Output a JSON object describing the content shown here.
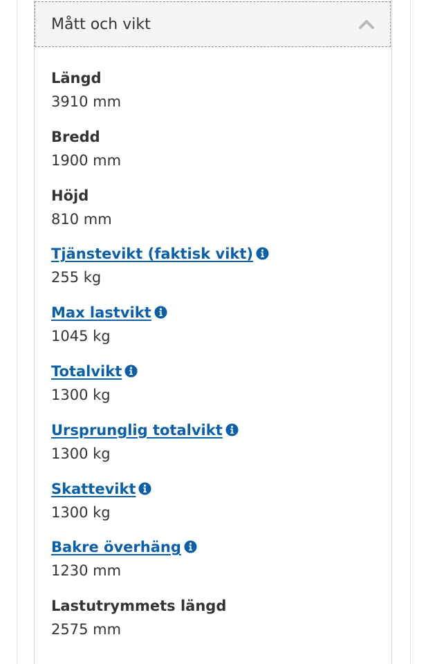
{
  "section": {
    "title": "Mått och vikt",
    "toggle_icon": "chevron-up-icon"
  },
  "rows": [
    {
      "label": "Längd",
      "value": "3910 mm",
      "link": false
    },
    {
      "label": "Bredd",
      "value": "1900 mm",
      "link": false
    },
    {
      "label": "Höjd",
      "value": "810 mm",
      "link": false
    },
    {
      "label": "Tjänstevikt (faktisk vikt)",
      "value": "255 kg",
      "link": true
    },
    {
      "label": "Max lastvikt",
      "value": "1045 kg",
      "link": true
    },
    {
      "label": "Totalvikt",
      "value": "1300 kg",
      "link": true
    },
    {
      "label": "Ursprunglig totalvikt",
      "value": "1300 kg",
      "link": true
    },
    {
      "label": "Skattevikt",
      "value": "1300 kg",
      "link": true
    },
    {
      "label": "Bakre överhäng",
      "value": "1230 mm",
      "link": true
    },
    {
      "label": "Lastutrymmets längd",
      "value": "2575 mm",
      "link": false
    }
  ],
  "colors": {
    "link": "#0b5ea8",
    "text": "#333333",
    "header_bg": "#f5f5f5",
    "chevron": "#b8b8b8"
  }
}
